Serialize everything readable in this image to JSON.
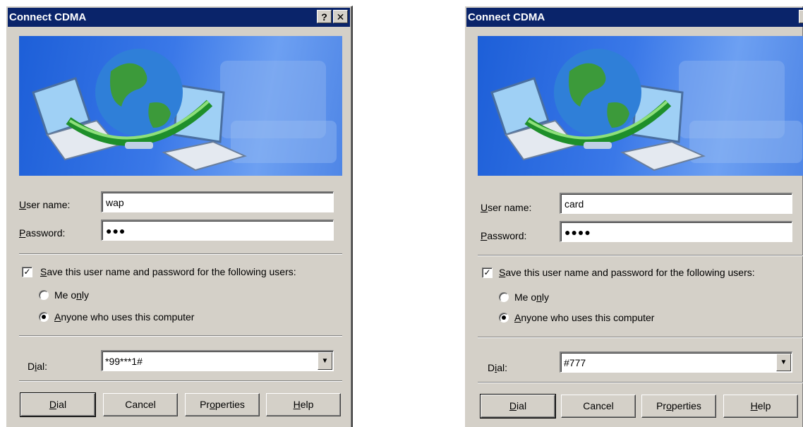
{
  "dialogs": [
    {
      "title": "Connect CDMA",
      "help_glyph": "?",
      "close_glyph": "✕",
      "user_label_key": "U",
      "user_label_rest": "ser name:",
      "user_value": "wap",
      "password_label_key": "P",
      "password_label_rest": "assword:",
      "password_mask": "●●●",
      "save_checked": true,
      "save_label_key": "S",
      "save_label_rest": "ave this user name and password for the following users:",
      "me_only_pre": "Me o",
      "me_only_key": "n",
      "me_only_post": "ly",
      "me_only_selected": false,
      "anyone_key": "A",
      "anyone_rest": "nyone who uses this computer",
      "anyone_selected": true,
      "dial_label_pre": "D",
      "dial_label_key": "i",
      "dial_label_post": "al:",
      "dial_value": "*99***1#",
      "btn_dial_key": "D",
      "btn_dial_rest": "ial",
      "btn_cancel": "Cancel",
      "btn_properties_pre": "Pr",
      "btn_properties_key": "o",
      "btn_properties_post": "perties",
      "btn_help_key": "H",
      "btn_help_rest": "elp"
    },
    {
      "title": "Connect CDMA",
      "help_glyph": "?",
      "close_glyph": "✕",
      "user_label_key": "U",
      "user_label_rest": "ser name:",
      "user_value": "card",
      "password_label_key": "P",
      "password_label_rest": "assword:",
      "password_mask": "●●●●",
      "save_checked": true,
      "save_label_key": "S",
      "save_label_rest": "ave this user name and password for the following users:",
      "me_only_pre": "Me o",
      "me_only_key": "n",
      "me_only_post": "ly",
      "me_only_selected": false,
      "anyone_key": "A",
      "anyone_rest": "nyone who uses this computer",
      "anyone_selected": true,
      "dial_label_pre": "D",
      "dial_label_key": "i",
      "dial_label_post": "al:",
      "dial_value": "#777",
      "btn_dial_key": "D",
      "btn_dial_rest": "ial",
      "btn_cancel": "Cancel",
      "btn_properties_pre": "Pr",
      "btn_properties_key": "o",
      "btn_properties_post": "perties",
      "btn_help_key": "H",
      "btn_help_rest": "elp"
    }
  ],
  "icons": {
    "checkmark": "✓",
    "dropdown_arrow": "▼"
  },
  "colors": {
    "titlebar": "#0a246a",
    "dialog_face": "#d4d0c8",
    "banner_blue": "#3a78e8"
  }
}
